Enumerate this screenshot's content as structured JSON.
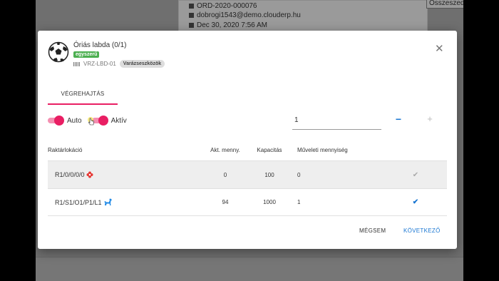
{
  "background": {
    "order_number": "ORD-2020-000076",
    "email": "dobrogi1543@demo.clouderp.hu",
    "date": "Dec 30, 2020 7:56 AM",
    "select_value": "Összeszed"
  },
  "modal": {
    "product_name": "Óriás labda (0/1)",
    "badge_unique": "egyszerű",
    "sku": "VRZ-LBD-01",
    "category_badge": "Varázseszközök",
    "tab_label": "VÉGREHAJTÁS",
    "toggle_auto_label": "Auto",
    "toggle_active_label": "Aktív",
    "quantity_value": "1",
    "minus_label": "−",
    "plus_label": "+",
    "close_label": "✕",
    "table": {
      "headers": [
        "Raktárlokáció",
        "Akt. menny.",
        "Kapacitás",
        "Műveleti mennyiség"
      ],
      "rows": [
        {
          "location": "R1/0/0/0/0",
          "current": "0",
          "capacity": "100",
          "operation": "0",
          "check": "✔"
        },
        {
          "location": "R1/S1/O1/P1/L1",
          "current": "94",
          "capacity": "1000",
          "operation": "1",
          "check": "✔"
        }
      ]
    },
    "cancel_label": "MÉGSEM",
    "next_label": "KÖVETKEZŐ"
  },
  "colors": {
    "accent_pink": "#e91e63",
    "primary_blue": "#1976d2",
    "badge_green": "#4caf50"
  },
  "icons": {
    "product": "soccer-ball-icon",
    "row1_location": "red-flower-icon",
    "row2_location": "blue-horse-icon",
    "barcode": "barcode-icon"
  }
}
